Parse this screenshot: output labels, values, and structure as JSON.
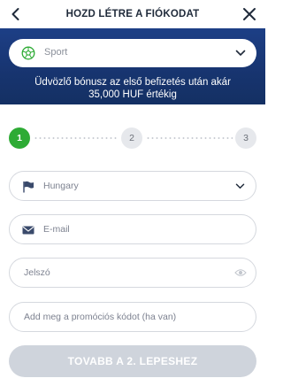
{
  "header": {
    "title": "HOZD LÉTRE A FIÓKODAT",
    "back_icon": "chevron-left-icon",
    "close_icon": "close-icon"
  },
  "banner": {
    "sport_select": {
      "value": "Sport",
      "icon": "soccer-ball-icon"
    },
    "promo_line1": "Üdvözlő bónusz az első befizetés után akár",
    "promo_line2": "35,000 HUF értékig",
    "colors": {
      "background": "#1a3a7c",
      "text": "#ffffff"
    }
  },
  "steps": {
    "items": [
      "1",
      "2",
      "3"
    ],
    "active_index": 0,
    "colors": {
      "active": "#2eab35",
      "inactive": "#e6e8ec"
    }
  },
  "form": {
    "country": {
      "value": "Hungary",
      "icon": "flag-icon"
    },
    "email": {
      "placeholder": "E-mail",
      "icon": "envelope-icon"
    },
    "password": {
      "placeholder": "Jelszó",
      "icon": "eye-icon"
    },
    "promo_code": {
      "placeholder": "Add meg a promóciós kódot (ha van)"
    }
  },
  "next_button": {
    "label": "TOVABB A 2. LEPESHEZ",
    "color": "#cfd4dc"
  }
}
